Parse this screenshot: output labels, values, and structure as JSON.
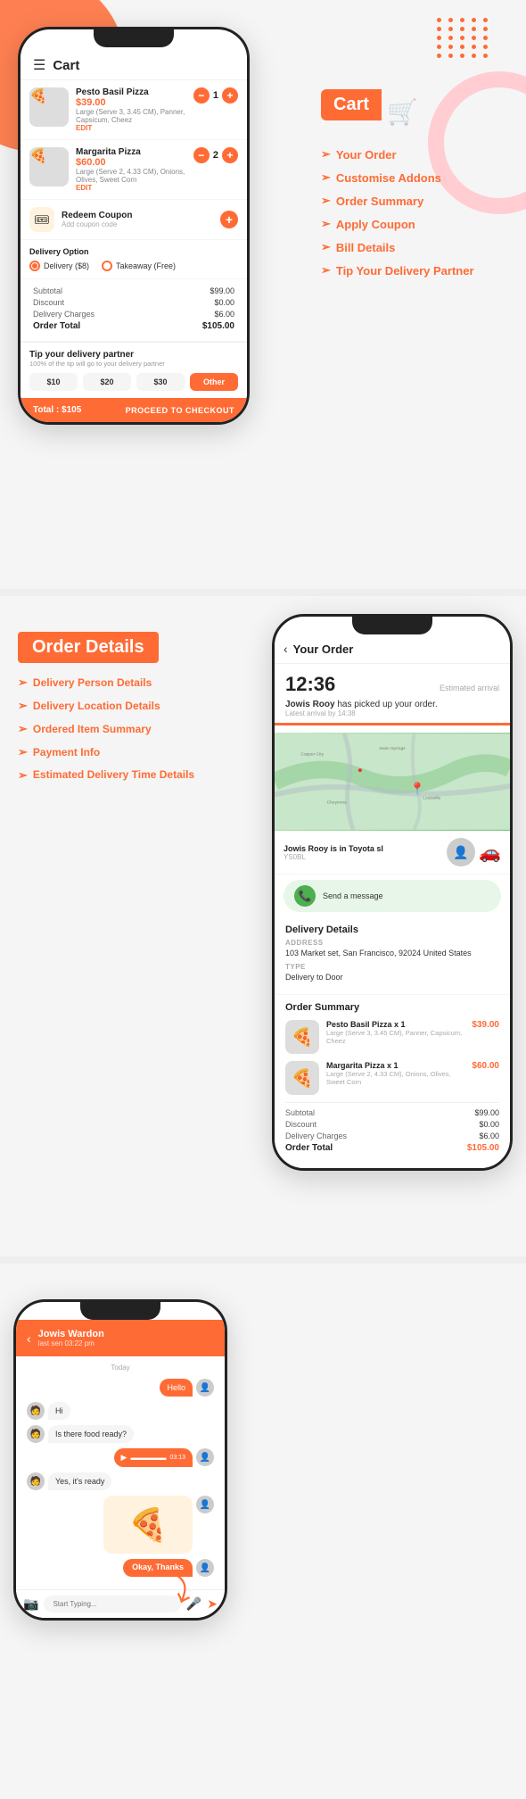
{
  "section1": {
    "cart": {
      "title": "Cart",
      "items": [
        {
          "name": "Pesto Basil Pizza",
          "price": "$39.00",
          "desc": "Large (Serve 3, 3.45 CM), Panner, Capsicum, Cheez",
          "qty": 1,
          "edit": "EDIT"
        },
        {
          "name": "Margarita Pizza",
          "price": "$60.00",
          "desc": "Large (Serve 2, 4.33 CM), Onions, Olives, Sweet Corn",
          "qty": 2,
          "edit": "EDIT"
        }
      ],
      "redeem": {
        "title": "Redeem Coupon",
        "sub": "Add coupon code"
      },
      "delivery_option_label": "Delivery Option",
      "delivery_option": "Delivery ($8)",
      "takeaway_option": "Takeaway (Free)",
      "subtotal_label": "Subtotal",
      "subtotal_val": "$99.00",
      "discount_label": "Discount",
      "discount_val": "$0.00",
      "delivery_label": "Delivery Charges",
      "delivery_val": "$6.00",
      "total_label": "Order Total",
      "total_val": "$105.00",
      "tip_title": "Tip your delivery partner",
      "tip_sub": "100% of the tip will go to your delivery partner",
      "tip_btns": [
        "$10",
        "$20",
        "$30",
        "Other"
      ],
      "checkout_total": "Total : $105",
      "checkout_btn": "PROCEED TO CHECKOUT"
    }
  },
  "section1_right": {
    "banner": "Cart",
    "menu": [
      "Your Order",
      "Customise Addons",
      "Order Summary",
      "Apply Coupon",
      "Bill Details",
      "Tip Your Delivery Partner"
    ]
  },
  "section2": {
    "banner": "Order Details",
    "menu": [
      "Delivery Person Details",
      "Delivery Location Details",
      "Ordered Item Summary",
      "Payment Info",
      "Estimated Delivery Time Details"
    ],
    "phone": {
      "header": "Your Order",
      "arrival_time": "12:36",
      "arrival_label": "Estimated arrival",
      "status_text_pre": "",
      "status_name": "Jowis Rooy",
      "status_text_post": " has picked up your order.",
      "status_sub": "Latest arrival by 14:38",
      "driver_name": "Jowis Rooy is in Toyota sl",
      "driver_vehicle": "YS0BL",
      "message_btn": "Send a message",
      "delivery_details_title": "Delivery Details",
      "address_label": "ADDRESS",
      "address_val": "103 Market set, San Francisco, 92024 United States",
      "type_label": "TYPE",
      "type_val": "Delivery to Door",
      "order_summary_title": "Order Summary",
      "order_items": [
        {
          "name": "Pesto Basil Pizza x 1",
          "desc": "Large (Serve 3, 3.45 CM), Panner, Capsicum, Cheez",
          "price": "$39.00"
        },
        {
          "name": "Margarita Pizza x 1",
          "desc": "Large (Serve 2, 4.33 CM), Onions, Olives, Sweet Corn",
          "price": "$60.00"
        }
      ],
      "subtotal_label": "Subtotal",
      "subtotal_val": "$99.00",
      "discount_label": "Discount",
      "discount_val": "$0.00",
      "delivery_label": "Delivery Charges",
      "delivery_val": "$6.00",
      "total_label": "Order Total",
      "total_val": "$105.00"
    }
  },
  "section3": {
    "chat": {
      "name": "Jowis Wardon",
      "sub": "last sen 03:22 pm",
      "date": "Today",
      "messages": [
        {
          "side": "right",
          "text": "Hello"
        },
        {
          "side": "left",
          "text": "Hi"
        },
        {
          "side": "left",
          "text": "Is there food ready?"
        },
        {
          "side": "right",
          "type": "audio",
          "time": "03:13"
        },
        {
          "side": "left",
          "text": "Yes, it's ready"
        },
        {
          "side": "right",
          "type": "image"
        },
        {
          "side": "right",
          "text": "Okay, Thanks"
        }
      ],
      "input_placeholder": "Start Typing...",
      "thanks": "Okay, Thanks"
    }
  },
  "icons": {
    "cart": "🛒",
    "pizza": "🍕",
    "coupon": "🎟",
    "phone": "📞",
    "back": "‹",
    "camera": "📷",
    "mic": "🎤",
    "send": "➤",
    "map_pin": "📍",
    "chevron": "➢",
    "menu_lines": "☰",
    "play": "▶"
  }
}
